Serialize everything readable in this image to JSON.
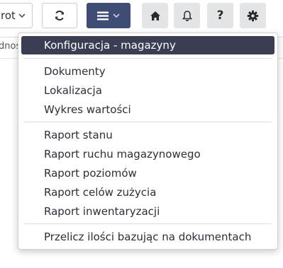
{
  "toolbar": {
    "dropdown_label": "rot",
    "column_fragment": "dnos",
    "icons": {
      "dropdown": "chevron-down-icon",
      "refresh": "refresh-icon",
      "menu": "hamburger-icon",
      "home": "home-icon",
      "bell": "bell-icon",
      "help": "question-icon",
      "settings": "gear-icon"
    },
    "help_glyph": "?",
    "colors": {
      "menu_button": "#3f4c74",
      "square_button": "#e4e5e6"
    }
  },
  "menu": {
    "groups": [
      {
        "items": [
          {
            "label": "Konfiguracja - magazyny",
            "active": true
          }
        ]
      },
      {
        "items": [
          {
            "label": "Dokumenty"
          },
          {
            "label": "Lokalizacja"
          },
          {
            "label": "Wykres wartości"
          }
        ]
      },
      {
        "items": [
          {
            "label": "Raport stanu"
          },
          {
            "label": "Raport ruchu magazynowego"
          },
          {
            "label": "Raport poziomów"
          },
          {
            "label": "Raport celów zużycia"
          },
          {
            "label": "Raport inwentaryzacji"
          }
        ]
      },
      {
        "items": [
          {
            "label": "Przelicz ilości bazując na dokumentach"
          }
        ]
      }
    ],
    "colors": {
      "active_bg": "#3b3d52",
      "active_text": "#ffffff",
      "text": "#2a2f38"
    }
  }
}
